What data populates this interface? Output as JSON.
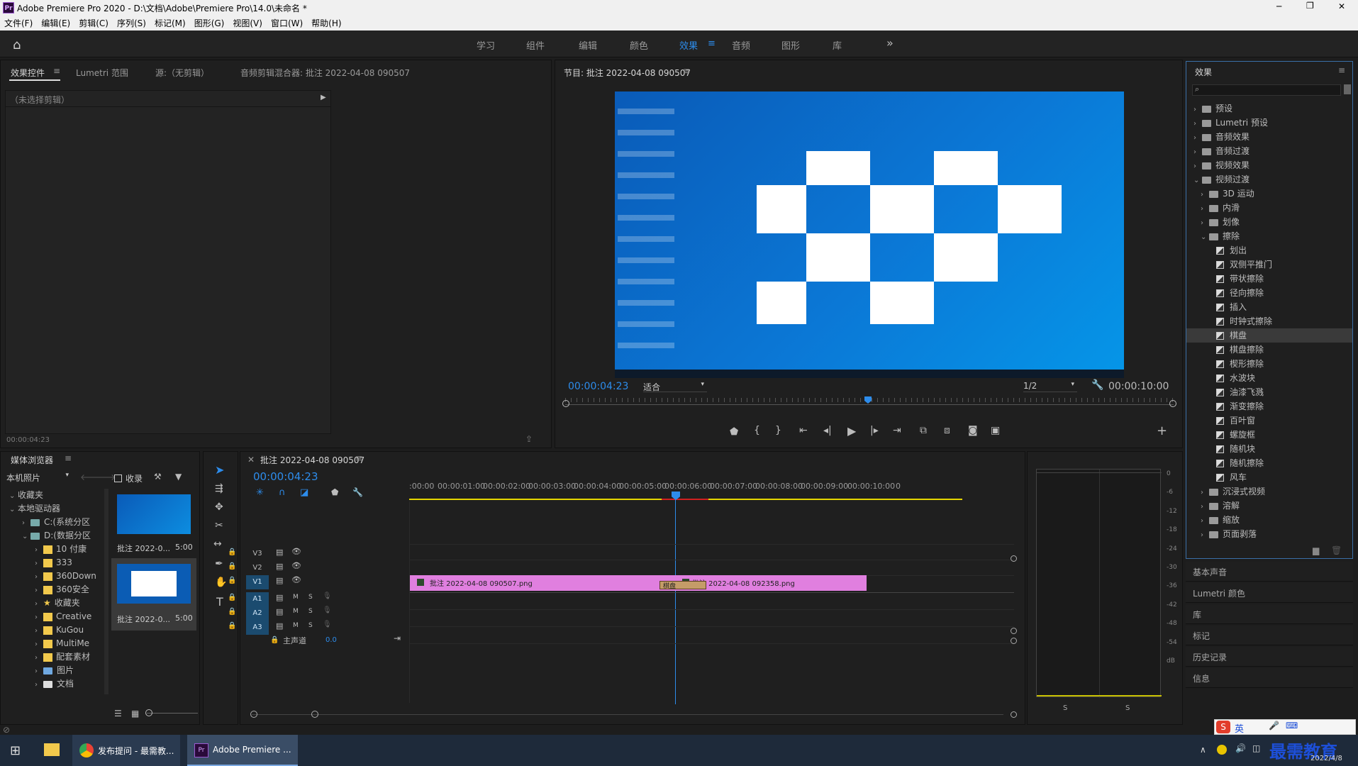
{
  "window": {
    "title": "Adobe Premiere Pro 2020 - D:\\文档\\Adobe\\Premiere Pro\\14.0\\未命名 *",
    "minimize": "─",
    "maximize": "❐",
    "close": "✕"
  },
  "menu": [
    "文件(F)",
    "编辑(E)",
    "剪辑(C)",
    "序列(S)",
    "标记(M)",
    "图形(G)",
    "视图(V)",
    "窗口(W)",
    "帮助(H)"
  ],
  "workspaces": [
    "学习",
    "组件",
    "编辑",
    "颜色",
    "效果",
    "音频",
    "图形",
    "库"
  ],
  "active_workspace": "效果",
  "overflow": "»",
  "source_panel": {
    "tabs": [
      "效果控件",
      "Lumetri 范围",
      "源:（无剪辑）",
      "音频剪辑混合器: 批注 2022-04-08 090507"
    ],
    "no_clip": "（未选择剪辑）",
    "timecode": "00:00:04:23"
  },
  "program": {
    "title": "节目: 批注 2022-04-08 090507",
    "timecode": "00:00:04:23",
    "fit": "适合",
    "resolution": "1/2",
    "duration": "00:00:10:00"
  },
  "project": {
    "title": "媒体浏览器",
    "location": "本机照片",
    "favorites_label": "收录",
    "tree": [
      {
        "label": "收藏夹",
        "indent": 0,
        "type": "none",
        "expanded": true
      },
      {
        "label": "本地驱动器",
        "indent": 0,
        "type": "none",
        "expanded": true
      },
      {
        "label": "C:(系统分区",
        "indent": 1,
        "type": "drive"
      },
      {
        "label": "D:(数据分区",
        "indent": 1,
        "type": "drive",
        "expanded": true
      },
      {
        "label": "10 付康",
        "indent": 2,
        "type": "folder"
      },
      {
        "label": "333",
        "indent": 2,
        "type": "folder"
      },
      {
        "label": "360Down",
        "indent": 2,
        "type": "folder"
      },
      {
        "label": "360安全",
        "indent": 2,
        "type": "folder"
      },
      {
        "label": "收藏夹",
        "indent": 2,
        "type": "star"
      },
      {
        "label": "Creative",
        "indent": 2,
        "type": "folder"
      },
      {
        "label": "KuGou",
        "indent": 2,
        "type": "folder"
      },
      {
        "label": "MultiMe",
        "indent": 2,
        "type": "folder"
      },
      {
        "label": "配套素材",
        "indent": 2,
        "type": "folder"
      },
      {
        "label": "图片",
        "indent": 2,
        "type": "pictures"
      },
      {
        "label": "文档",
        "indent": 2,
        "type": "doc"
      }
    ],
    "clips": [
      {
        "name": "批注 2022-0...",
        "duration": "5:00"
      },
      {
        "name": "批注 2022-0...",
        "duration": "5:00"
      }
    ]
  },
  "timeline": {
    "title": "批注 2022-04-08 090507",
    "timecode": "00:00:04:23",
    "ruler": [
      ":00:00",
      "00:00:01:00",
      "00:00:02:00",
      "00:00:03:00",
      "00:00:04:00",
      "00:00:05:00",
      "00:00:06:00",
      "00:00:07:00",
      "00:00:08:00",
      "00:00:09:00",
      "00:00:10:00",
      "0"
    ],
    "video_tracks": [
      "V3",
      "V2",
      "V1"
    ],
    "audio_tracks": [
      "A1",
      "A2",
      "A3"
    ],
    "master": {
      "label": "主声道",
      "value": "0.0"
    },
    "mute": "M",
    "solo": "S",
    "clip1": "批注 2022-04-08 090507.png",
    "clip2": "批注 2022-04-08 092358.png",
    "transition": "棋盘"
  },
  "meter": {
    "scale": [
      "0",
      "-6",
      "-12",
      "-18",
      "-24",
      "-30",
      "-36",
      "-42",
      "-48",
      "-54",
      "dB"
    ],
    "solo": [
      "S",
      "S"
    ]
  },
  "effects": {
    "title": "效果",
    "items": [
      {
        "label": "预设",
        "level": 0,
        "type": "folder",
        "open": false
      },
      {
        "label": "Lumetri 预设",
        "level": 0,
        "type": "folder",
        "open": false
      },
      {
        "label": "音频效果",
        "level": 0,
        "type": "folder",
        "open": false
      },
      {
        "label": "音频过渡",
        "level": 0,
        "type": "folder",
        "open": false
      },
      {
        "label": "视频效果",
        "level": 0,
        "type": "folder",
        "open": false
      },
      {
        "label": "视频过渡",
        "level": 0,
        "type": "folder",
        "open": true
      },
      {
        "label": "3D 运动",
        "level": 1,
        "type": "folder",
        "open": false
      },
      {
        "label": "内滑",
        "level": 1,
        "type": "folder",
        "open": false
      },
      {
        "label": "划像",
        "level": 1,
        "type": "folder",
        "open": false
      },
      {
        "label": "擦除",
        "level": 1,
        "type": "folder",
        "open": true
      },
      {
        "label": "划出",
        "level": 2,
        "type": "fx"
      },
      {
        "label": "双侧平推门",
        "level": 2,
        "type": "fx"
      },
      {
        "label": "带状擦除",
        "level": 2,
        "type": "fx"
      },
      {
        "label": "径向擦除",
        "level": 2,
        "type": "fx"
      },
      {
        "label": "插入",
        "level": 2,
        "type": "fx"
      },
      {
        "label": "时钟式擦除",
        "level": 2,
        "type": "fx"
      },
      {
        "label": "棋盘",
        "level": 2,
        "type": "fx",
        "selected": true
      },
      {
        "label": "棋盘擦除",
        "level": 2,
        "type": "fx"
      },
      {
        "label": "楔形擦除",
        "level": 2,
        "type": "fx"
      },
      {
        "label": "水波块",
        "level": 2,
        "type": "fx"
      },
      {
        "label": "油漆飞溅",
        "level": 2,
        "type": "fx"
      },
      {
        "label": "渐变擦除",
        "level": 2,
        "type": "fx"
      },
      {
        "label": "百叶窗",
        "level": 2,
        "type": "fx"
      },
      {
        "label": "螺旋框",
        "level": 2,
        "type": "fx"
      },
      {
        "label": "随机块",
        "level": 2,
        "type": "fx"
      },
      {
        "label": "随机擦除",
        "level": 2,
        "type": "fx"
      },
      {
        "label": "风车",
        "level": 2,
        "type": "fx"
      },
      {
        "label": "沉浸式视频",
        "level": 1,
        "type": "folder",
        "open": false
      },
      {
        "label": "溶解",
        "level": 1,
        "type": "folder",
        "open": false
      },
      {
        "label": "缩放",
        "level": 1,
        "type": "folder",
        "open": false
      },
      {
        "label": "页面剥落",
        "level": 1,
        "type": "folder",
        "open": false
      }
    ],
    "sub_panels": [
      "基本声音",
      "Lumetri 颜色",
      "库",
      "标记",
      "历史记录",
      "信息"
    ]
  },
  "taskbar": {
    "apps": [
      {
        "label": "发布提问 - 最需教...",
        "icon": "chrome-icon"
      },
      {
        "label": "Adobe Premiere ...",
        "icon": "premiere-icon"
      }
    ],
    "tray_lang": "英",
    "date": "2022/4/8",
    "watermark": "最需教育"
  },
  "colors": {
    "accent": "#2d8ceb",
    "clip_pink": "#e07fdf",
    "transition": "#c59c68"
  }
}
